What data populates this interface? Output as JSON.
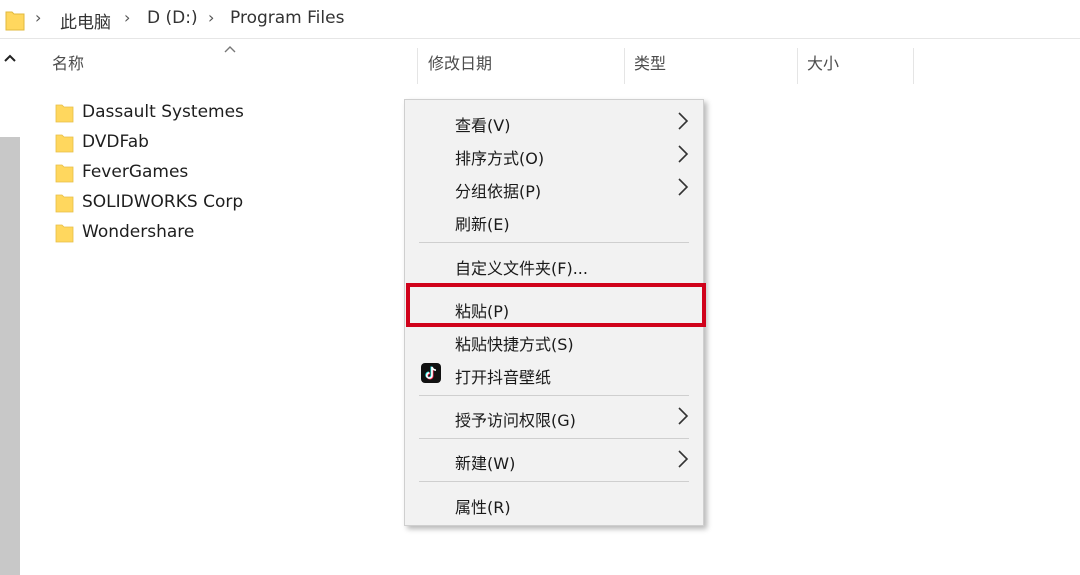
{
  "address_bar": {
    "crumbs": [
      "此电脑",
      "D (D:)",
      "Program Files"
    ]
  },
  "columns": {
    "name": "名称",
    "date_modified": "修改日期",
    "type": "类型",
    "size": "大小"
  },
  "files": [
    {
      "name": "Dassault Systemes"
    },
    {
      "name": "DVDFab"
    },
    {
      "name": "FeverGames"
    },
    {
      "name": "SOLIDWORKS Corp"
    },
    {
      "name": "Wondershare"
    }
  ],
  "context_menu": {
    "items": [
      {
        "label": "查看(V)"
      },
      {
        "label": "排序方式(O)"
      },
      {
        "label": "分组依据(P)"
      },
      {
        "label": "刷新(E)"
      },
      {
        "label": "自定义文件夹(F)..."
      },
      {
        "label": "粘贴(P)"
      },
      {
        "label": "粘贴快捷方式(S)"
      },
      {
        "label": "打开抖音壁纸"
      },
      {
        "label": "授予访问权限(G)"
      },
      {
        "label": "新建(W)"
      },
      {
        "label": "属性(R)"
      }
    ]
  },
  "colors": {
    "folder": "#ffd75e",
    "highlight": "#d0021b"
  }
}
